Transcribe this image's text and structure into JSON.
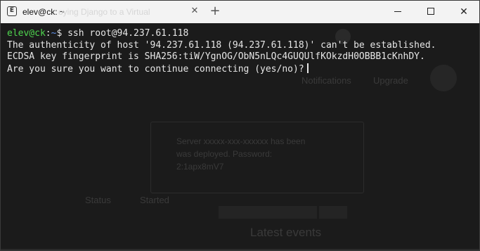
{
  "window": {
    "title": "elev@ck: ~",
    "background_tab_title": "oying Django to a Virtual"
  },
  "titlebar": {
    "close_tab_glyph": "✕",
    "new_tab_glyph": "+",
    "close_window_glyph": "✕"
  },
  "terminal": {
    "prompt_user": "elev@ck",
    "prompt_sep": ":",
    "prompt_path": "~",
    "prompt_symbol": "$",
    "command": " ssh root@94.237.61.118",
    "line2": "The authenticity of host '94.237.61.118 (94.237.61.118)' can't be established.",
    "line3": "ECDSA key fingerprint is SHA256:tiW/YgnOG/ObN5nLQc4GUQUlfKOkzdH0OBBB1cKnhDY.",
    "line4": "Are you sure you want to continue connecting (yes/no)?"
  },
  "ghost": {
    "notifications": "Notifications",
    "upgrade": "Upgrade",
    "card_line1": "Server xxxxx-xxx-xxxxxx has been",
    "card_line2": "was deployed. Password:",
    "card_line3": "2:1apx8mV7",
    "started_label": "Started",
    "status_label": "Status",
    "latest_events": "Latest events"
  },
  "colors": {
    "terminal_bg": "#1b1b1b",
    "prompt_user": "#4fd64f",
    "prompt_path": "#5f8fe8",
    "text": "#e6e6e6",
    "titlebar_bg": "#f3f3f3"
  }
}
